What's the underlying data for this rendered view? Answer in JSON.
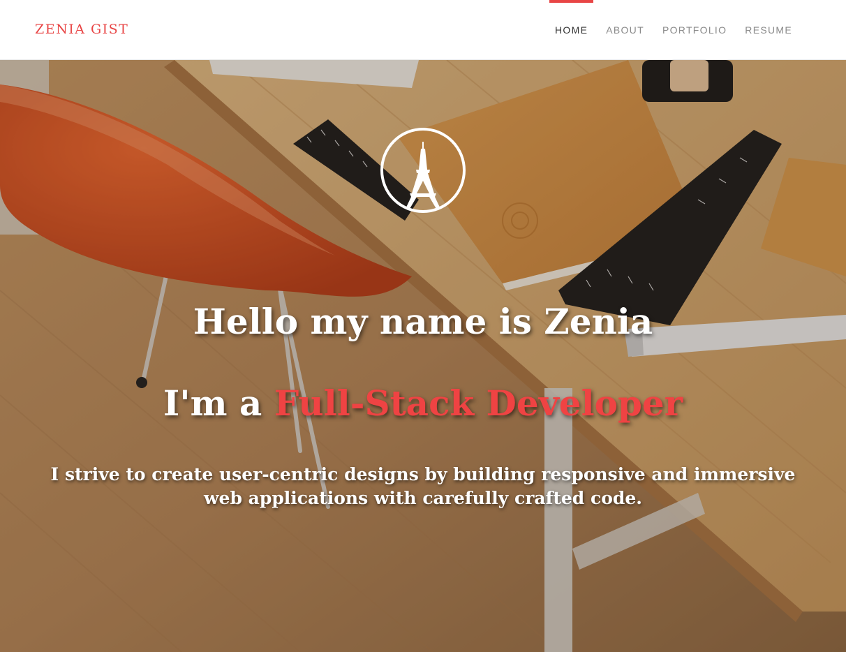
{
  "navbar": {
    "brand": "ZENIA GIST",
    "items": [
      {
        "label": "HOME",
        "active": true
      },
      {
        "label": "ABOUT",
        "active": false
      },
      {
        "label": "PORTFOLIO",
        "active": false
      },
      {
        "label": "RESUME",
        "active": false
      }
    ]
  },
  "hero": {
    "emblem_icon": "eiffel-tower-icon",
    "title": "Hello my name is Zenia",
    "role_prefix": "I'm a ",
    "role_highlight": "Full-Stack Developer",
    "tagline": "I strive to create user-centric designs by building responsive and immersive web applications with carefully crafted code."
  },
  "colors": {
    "accent": "#e84545",
    "nav_text": "#8a8a8a",
    "nav_active_text": "#333333",
    "hero_text": "#ffffff"
  }
}
